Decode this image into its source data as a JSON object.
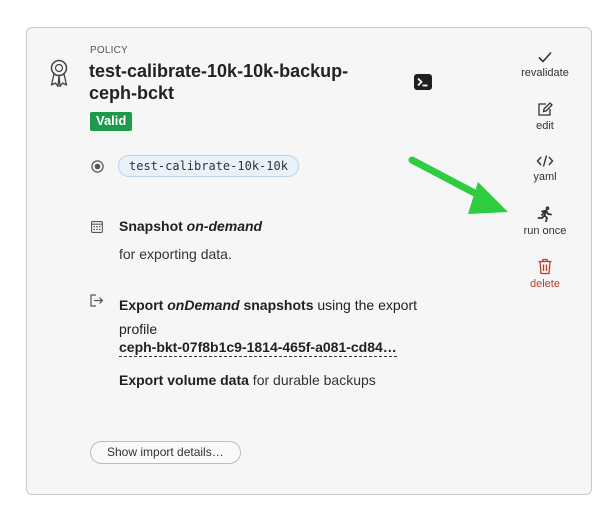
{
  "policy": {
    "eyebrow": "POLICY",
    "title": "test-calibrate-10k-10k-backup-ceph-bckt",
    "status": "Valid",
    "target": "test-calibrate-10k-10k"
  },
  "snapshot": {
    "label_prefix": "Snapshot ",
    "label_mode": "on-demand",
    "description": "for exporting data."
  },
  "export": {
    "label_prefix": "Export ",
    "label_mode": "onDemand",
    "label_suffix": " snapshots",
    "text_suffix": " using the export profile",
    "profile": "ceph-bkt-07f8b1c9-1814-465f-a081-cd84…",
    "volume_bold": "Export volume data",
    "volume_rest": " for durable backups"
  },
  "import_button_label": "Show import details…",
  "actions": {
    "revalidate": "revalidate",
    "edit": "edit",
    "yaml": "yaml",
    "run_once": "run once",
    "delete": "delete"
  },
  "colors": {
    "valid_badge": "#1e9a4d",
    "delete": "#c0392b",
    "arrow": "#2ecc40",
    "chip_bg": "#e9f2fb"
  },
  "icons": [
    "award-ribbon-icon",
    "terminal-icon",
    "target-icon",
    "calendar-icon",
    "export-icon",
    "check-icon",
    "edit-icon",
    "code-icon",
    "running-person-icon",
    "trash-icon",
    "green-arrow-annotation"
  ]
}
